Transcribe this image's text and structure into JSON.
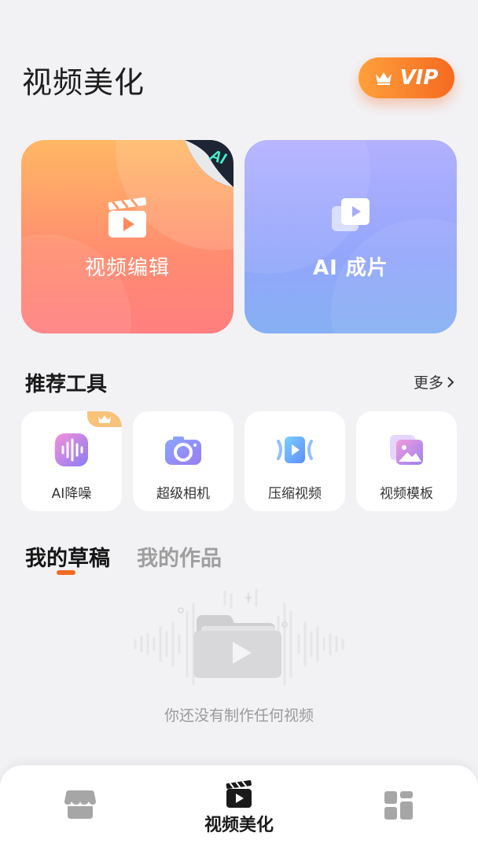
{
  "header": {
    "title": "视频美化",
    "vip_label": "VIP"
  },
  "cards": [
    {
      "label": "视频编辑",
      "badge": "AI"
    },
    {
      "label": "AI 成片"
    }
  ],
  "tools_section": {
    "title": "推荐工具",
    "more_label": "更多"
  },
  "tools": [
    {
      "label": "AI降噪",
      "icon": "audio-wave-icon"
    },
    {
      "label": "超级相机",
      "icon": "camera-icon"
    },
    {
      "label": "压缩视频",
      "icon": "compress-video-icon"
    },
    {
      "label": "视频模板",
      "icon": "template-image-icon"
    }
  ],
  "tabs": [
    {
      "label": "我的草稿",
      "active": true
    },
    {
      "label": "我的作品",
      "active": false
    }
  ],
  "empty_state": {
    "text": "你还没有制作任何视频"
  },
  "bottom_nav": {
    "items": [
      {
        "icon": "shop-icon"
      },
      {
        "label": "视频美化",
        "icon": "clapperboard-icon",
        "active": true
      },
      {
        "icon": "grid-icon"
      }
    ]
  },
  "colors": {
    "accent": "#f36b22",
    "vip_gradient": [
      "#ffa03c",
      "#f56a20"
    ]
  }
}
